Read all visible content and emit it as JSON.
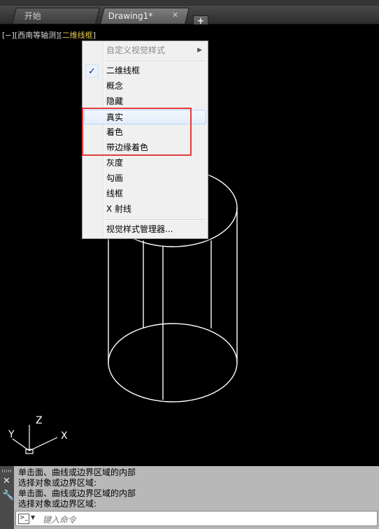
{
  "tabs": [
    {
      "label": "开始"
    },
    {
      "label": "Drawing1*",
      "close": "✕"
    }
  ],
  "new_tab": "+",
  "viewport": {
    "label_prefix": "[−][西南等轴测][",
    "label_style": "二维线框",
    "label_suffix": "]"
  },
  "ucs": {
    "x": "X",
    "y": "Y",
    "z": "Z"
  },
  "menu": {
    "custom": "自定义视觉样式",
    "items": [
      {
        "label": "二维线框",
        "checked": true,
        "check": "✓"
      },
      {
        "label": "概念"
      },
      {
        "label": "隐藏"
      },
      {
        "label": "真实"
      },
      {
        "label": "着色"
      },
      {
        "label": "带边缘着色"
      },
      {
        "label": "灰度"
      },
      {
        "label": "勾画"
      },
      {
        "label": "线框"
      },
      {
        "label": "X 射线"
      }
    ],
    "manager": "视觉样式管理器..."
  },
  "command": {
    "history": [
      "单击面、曲线或边界区域的内部",
      "选择对象或边界区域:",
      "单击面、曲线或边界区域的内部",
      "选择对象或边界区域:"
    ],
    "placeholder": "键入命令"
  },
  "colors": {
    "highlight": "#e8c84a",
    "annotation": "#e53b3b"
  }
}
